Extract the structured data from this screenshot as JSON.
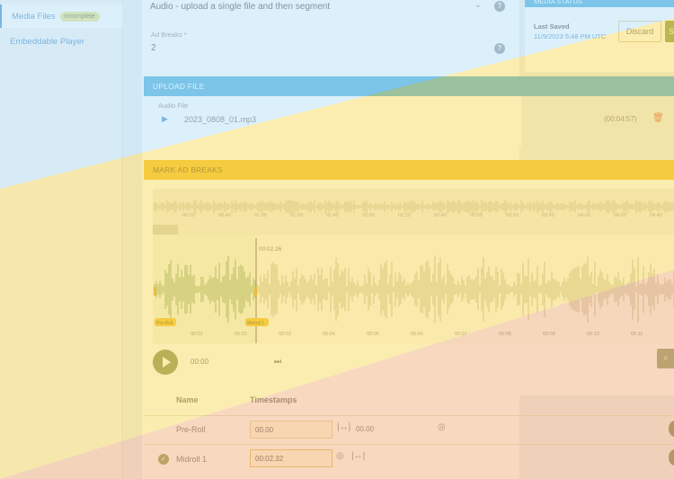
{
  "sidebar": {
    "items": [
      {
        "label": "Media Files",
        "badge": "Incomplete"
      },
      {
        "label": "Embeddable Player"
      }
    ]
  },
  "audio": {
    "mode_value": "Audio - upload a single file and then segment",
    "ad_breaks_label": "Ad Breaks *",
    "ad_breaks_value": "2"
  },
  "upload": {
    "header": "UPLOAD FILE",
    "file_label": "Audio File",
    "file_name": "2023_0808_01.mp3",
    "duration": "(00:04:57)"
  },
  "media_status": {
    "header": "MEDIA STATUS",
    "last_saved_label": "Last Saved",
    "last_saved_value": "11/9/2023 5:48 PM UTC",
    "discard_label": "Discard",
    "save_label": "S"
  },
  "ad_breaks_panel": {
    "header": "MARK AD BREAKS",
    "overview_ticks": [
      "00:20",
      "00:40",
      "01:00",
      "01:20",
      "01:40",
      "02:00",
      "02:20",
      "02:40",
      "03:00",
      "03:20",
      "03:40",
      "04:00",
      "04:20",
      "04:40"
    ],
    "detail_ticks": [
      "00:01",
      "00:02",
      "00:03",
      "00:04",
      "00:05",
      "00:06",
      "00:07",
      "00:08",
      "00:09",
      "00:10",
      "00:11"
    ],
    "cursor_time": "00:02.26",
    "marker_left": "Pre-Roll",
    "marker_right": "Midroll 1",
    "play_time": "00:00"
  },
  "table": {
    "col_name": "Name",
    "col_timestamps": "Timestamps",
    "rows": [
      {
        "name": "Pre-Roll",
        "start": "00.00",
        "end": "00.00"
      },
      {
        "name": "Midroll 1",
        "start": "00:02.32"
      }
    ]
  },
  "colors": {
    "blue_tint": "#bfe3f7",
    "yellow_tint": "#f7dc6f",
    "orange_tint": "#f3b98a"
  }
}
